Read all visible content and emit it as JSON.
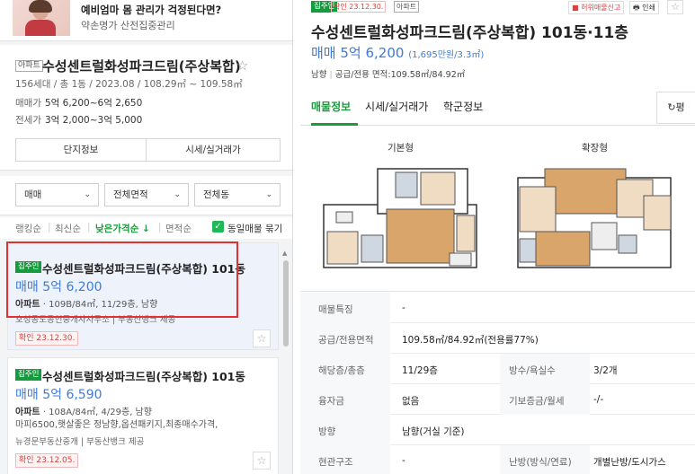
{
  "ad": {
    "title": "예비엄마 몸 관리가 걱정된다면?",
    "subtitle": "약손명가 산전집중관리"
  },
  "complex": {
    "type_badge": "아파트",
    "name": "수성센트럴화성파크드림(주상복합)",
    "summary": "156세대 / 총 1동 / 2023.08 / 108.29㎡ ~ 109.58㎡",
    "sale_label": "매매가",
    "sale_value": "5억 6,200~6억 2,650",
    "jeonse_label": "전세가",
    "jeonse_value": "3억 2,000~3억 5,000",
    "btn_info": "단지정보",
    "btn_price": "시세/실거래가"
  },
  "filters": {
    "deal": "매매",
    "area": "전체면적",
    "dong": "전체동"
  },
  "sorts": {
    "ranking": "랭킹순",
    "latest": "최신순",
    "lowprice": "낮은가격순 ↓",
    "area": "면적순",
    "bundle": "동일매물 묶기"
  },
  "listings": [
    {
      "tag": "집주인",
      "title": "수성센트럴화성파크드림(주상복합) 101동",
      "price": "매매 5억 6,200",
      "type": "아파트",
      "spec": "109B/84㎡, 11/29층, 남향",
      "broker": "호성공도공인중개사사무소 | 부동산뱅크 제공",
      "confirm": "확인 23.12.30."
    },
    {
      "tag": "집주인",
      "title": "수성센트럴화성파크드림(주상복합) 101동",
      "price": "매매 5억 6,590",
      "type": "아파트",
      "spec": "108A/84㎡, 4/29층, 남향",
      "desc": "마피6500,햇살좋은 정남향,옵션패키지,최종매수가격,",
      "broker": "뉴경문부동산중개 | 부동산뱅크 제공",
      "confirm": "확인 23.12.05."
    }
  ],
  "detail": {
    "tag": "집주인",
    "confirm": "확인 23.12.30.",
    "type": "아파트",
    "report": "허위매물신고",
    "print": "인쇄",
    "title": "수성센트럴화성파크드림(주상복합) 101동·11층",
    "price": "매매 5억 6,200",
    "price_per": "(1,695만원/3.3㎡)",
    "meta_dir": "남향",
    "meta_area": "공급/전용 면적:109.58㎡/84.92㎡",
    "tabs": [
      "매물정보",
      "시세/실거래가",
      "학군정보"
    ],
    "refresh": "평",
    "plan_basic": "기본형",
    "plan_ext": "확장형",
    "rows": [
      {
        "k": "매물특징",
        "v": "-"
      },
      {
        "k": "공급/전용면적",
        "v": "109.58㎡/84.92㎡(전용률77%)"
      },
      {
        "k": "해당층/총층",
        "v": "11/29층",
        "k2": "방수/욕실수",
        "v2": "3/2개"
      },
      {
        "k": "융자금",
        "v": "없음",
        "k2": "기보증금/월세",
        "v2": "-/-"
      },
      {
        "k": "방향",
        "v": "남향(거실 기준)"
      },
      {
        "k": "현관구조",
        "v": "-",
        "k2": "난방(방식/연료)",
        "v2": "개별난방/도시가스"
      }
    ]
  },
  "colors": {
    "accent_green": "#1a9b3c",
    "price_blue": "#3e7bd9",
    "confirm_red": "#e53c3c",
    "highlight_red": "#e53030"
  }
}
